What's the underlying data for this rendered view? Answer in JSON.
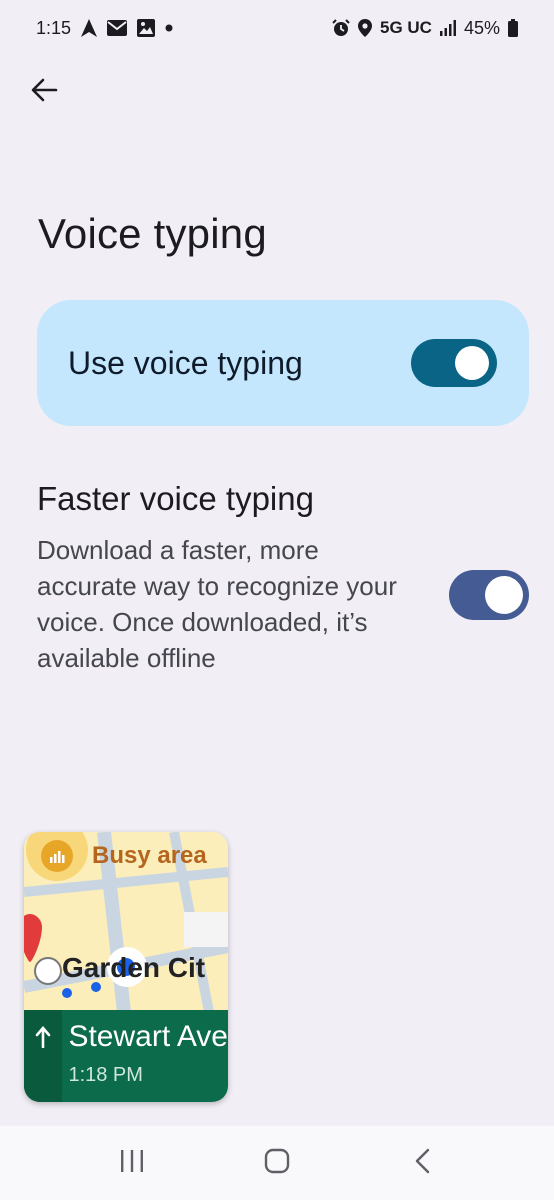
{
  "status_bar": {
    "time": "1:15",
    "left_icons": [
      "navigation-arrow-icon",
      "mail-icon",
      "image-icon",
      "dot-icon"
    ],
    "right_icons": [
      "alarm-icon",
      "location-pin-icon",
      "signal-icon",
      "battery-icon"
    ],
    "network": "5G UC",
    "battery": "45%"
  },
  "header": {
    "back_icon": "arrow-back-icon",
    "title": "Voice typing"
  },
  "main_toggle": {
    "label": "Use voice typing",
    "checked": true,
    "track_color": "#0a6485",
    "card_color": "#c4e7fd"
  },
  "faster_typing": {
    "title": "Faster voice typing",
    "description": "Download a faster, more accurate way to recognize your voice. Once downloaded, it’s available offline",
    "checked": true,
    "track_color": "#445b93"
  },
  "pip_navigation": {
    "busy_label": "Busy area",
    "map_label": "Garden Cit",
    "street": "Stewart Ave",
    "eta": "1:18 PM",
    "direction_icon": "arrow-up-icon"
  },
  "system_nav": {
    "recents_icon": "recents-icon",
    "home_icon": "home-icon",
    "back_icon": "back-chevron-icon"
  }
}
